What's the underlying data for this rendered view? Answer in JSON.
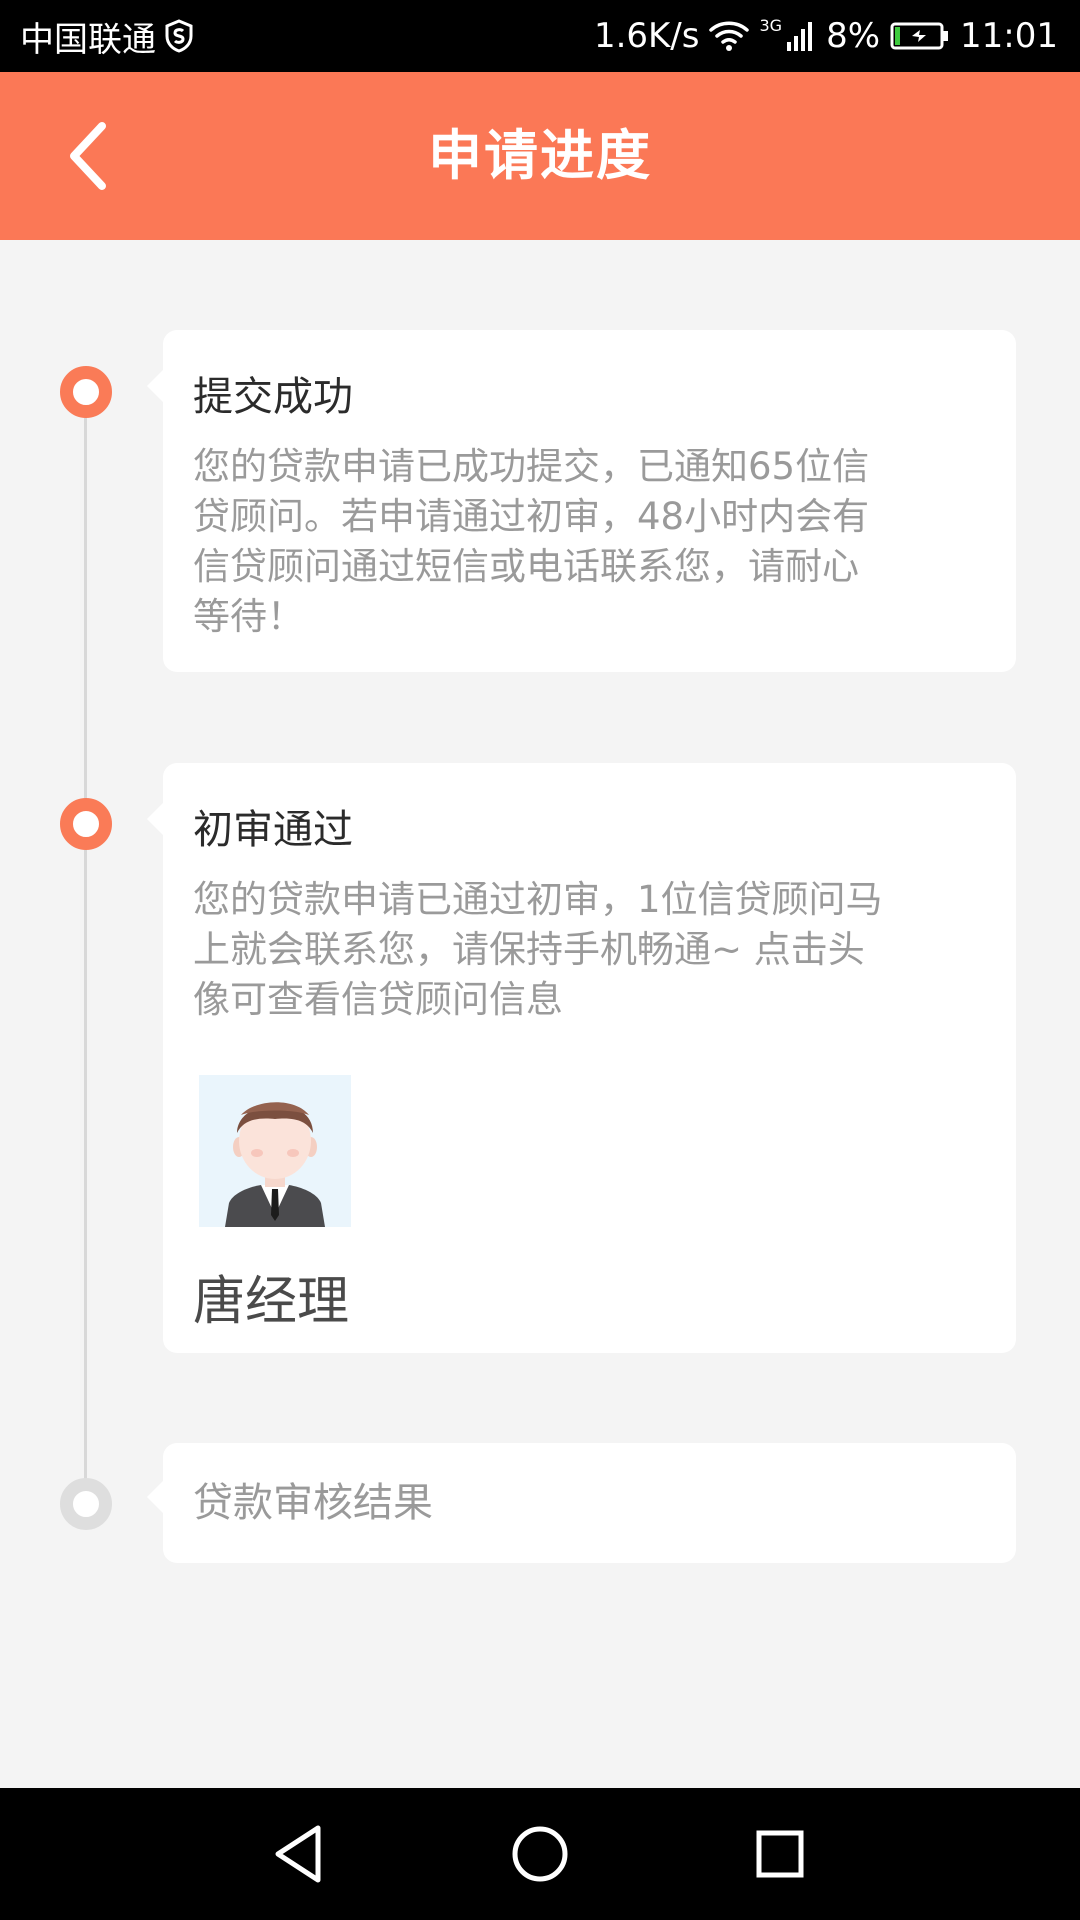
{
  "status_bar": {
    "carrier": "中国联通",
    "net_speed": "1.6K/s",
    "network_type": "3G",
    "battery": "8%",
    "time": "11:01"
  },
  "header": {
    "title": "申请进度",
    "back_icon": "chevron-left-icon"
  },
  "timeline": {
    "steps": [
      {
        "title": "提交成功",
        "description_lines": [
          "您的贷款申请已成功提交，已通知65位信",
          "贷顾问。若申请通过初审，48小时内会有",
          "信贷顾问通过短信或电话联系您，请耐心",
          "等待！"
        ],
        "status": "done"
      },
      {
        "title": "初审通过",
        "description_lines": [
          "您的贷款申请已通过初审，1位信贷顾问马",
          "上就会联系您，请保持手机畅通~ 点击头",
          "像可查看信贷顾问信息"
        ],
        "status": "done",
        "advisor": {
          "name": "唐经理"
        }
      },
      {
        "title": "贷款审核结果",
        "status": "pending"
      }
    ]
  },
  "colors": {
    "accent": "#fb7856",
    "pending": "#dedede",
    "background": "#f4f4f4"
  },
  "nav_bar": {
    "back": "triangle-back-icon",
    "home": "circle-home-icon",
    "recents": "square-recents-icon"
  }
}
